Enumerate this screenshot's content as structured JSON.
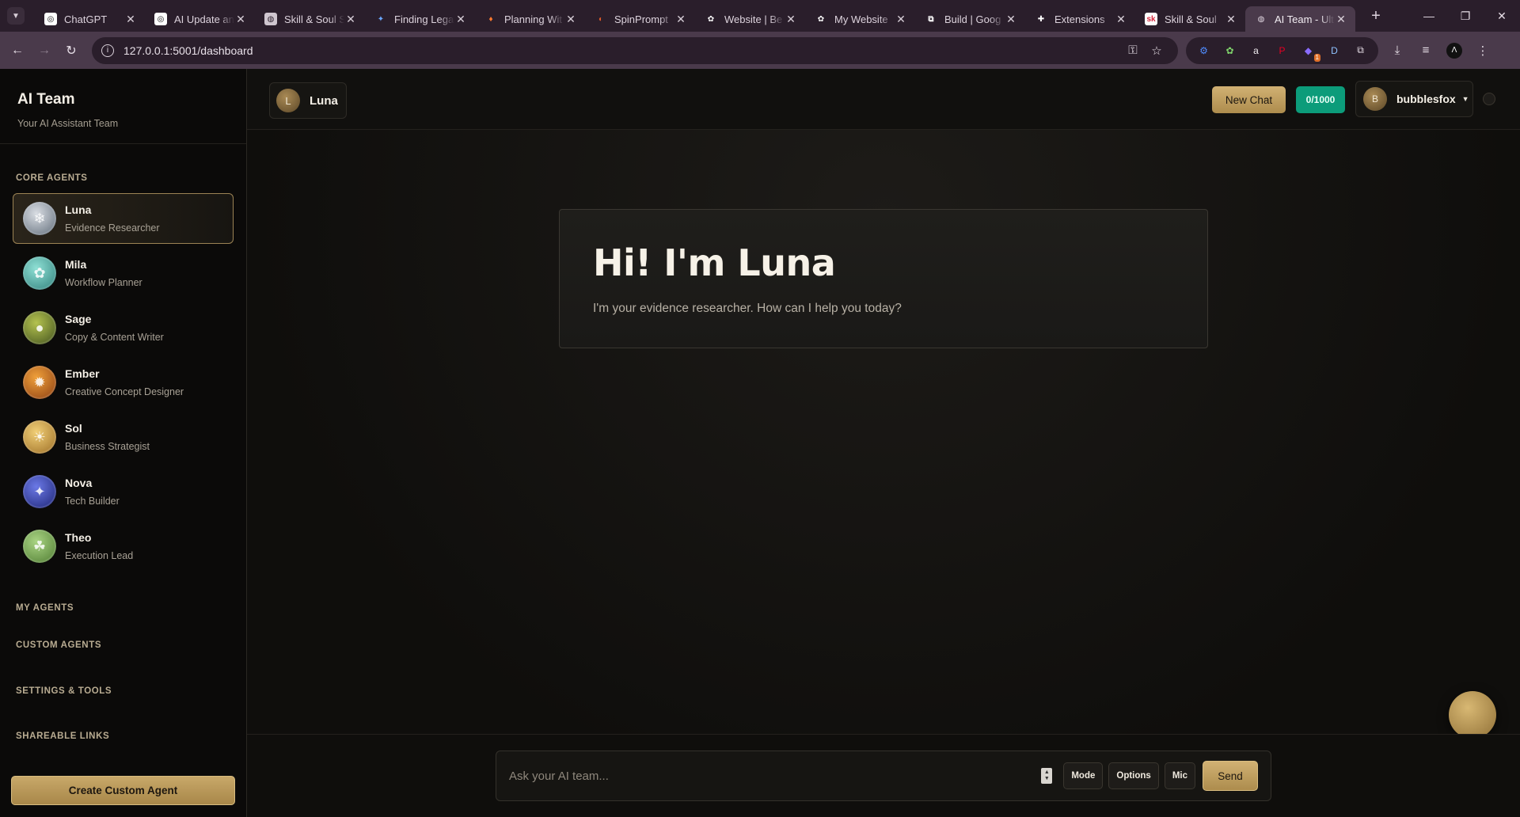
{
  "browser": {
    "tabs": [
      {
        "title": "ChatGPT",
        "favicon_bg": "#ffffff",
        "favicon_fg": "#111111",
        "favicon_glyph": "◎"
      },
      {
        "title": "AI Update and",
        "favicon_bg": "#ffffff",
        "favicon_fg": "#111111",
        "favicon_glyph": "◎"
      },
      {
        "title": "Skill & Soul S",
        "favicon_bg": "#cfc6cf",
        "favicon_fg": "#2a1e2b",
        "favicon_glyph": "◍"
      },
      {
        "title": "Finding Lega",
        "favicon_bg": "#2a1e2b",
        "favicon_fg": "#6aa7ff",
        "favicon_glyph": "✦"
      },
      {
        "title": "Planning Wit",
        "favicon_bg": "#2a1e2b",
        "favicon_fg": "#ff7a2f",
        "favicon_glyph": "♦"
      },
      {
        "title": "SpinPrompt",
        "favicon_bg": "#2a1e2b",
        "favicon_fg": "#e05a2a",
        "favicon_glyph": "◐"
      },
      {
        "title": "Website | Be",
        "favicon_bg": "#2a1e2b",
        "favicon_fg": "#ffffff",
        "favicon_glyph": "✿"
      },
      {
        "title": "My Website",
        "favicon_bg": "#2a1e2b",
        "favicon_fg": "#ffffff",
        "favicon_glyph": "✿"
      },
      {
        "title": "Build | Goog",
        "favicon_bg": "#2a1e2b",
        "favicon_fg": "#ffffff",
        "favicon_glyph": "⧉"
      },
      {
        "title": "Extensions",
        "favicon_bg": "#2a1e2b",
        "favicon_fg": "#ffffff",
        "favicon_glyph": "✚"
      },
      {
        "title": "Skill & Soul",
        "favicon_bg": "#ffffff",
        "favicon_fg": "#d6243a",
        "favicon_glyph": "sk"
      },
      {
        "title": "AI Team - Ult",
        "favicon_bg": "#4a3a4b",
        "favicon_fg": "#e0d6e0",
        "favicon_glyph": "◍",
        "active": true
      }
    ],
    "url": "127.0.0.1:5001/dashboard",
    "extensions": [
      {
        "name": "settings-extension-icon",
        "glyph": "⚙",
        "color": "#4f8cff"
      },
      {
        "name": "puzzle-green-extension-icon",
        "glyph": "✿",
        "color": "#7fd36b"
      },
      {
        "name": "a-extension-icon",
        "glyph": "a",
        "color": "#f2eef2"
      },
      {
        "name": "pinterest-extension-icon",
        "glyph": "P",
        "color": "#e60023"
      },
      {
        "name": "badge-extension-icon",
        "glyph": "◆",
        "color": "#8a6cff"
      },
      {
        "name": "d-extension-icon",
        "glyph": "D",
        "color": "#8fc3ff"
      },
      {
        "name": "extensions-puzzle-icon",
        "glyph": "⧉",
        "color": "#e8e0e8"
      }
    ],
    "extension_badge": "1"
  },
  "sidebar": {
    "brand_title": "AI Team",
    "brand_subtitle": "Your AI Assistant Team",
    "core_title": "CORE AGENTS",
    "agents": [
      {
        "name": "Luna",
        "role": "Evidence Researcher",
        "glyph": "❄",
        "bg": "radial-gradient(circle at 40% 35%, #d9dde3, #5f6b78)",
        "active": true
      },
      {
        "name": "Mila",
        "role": "Workflow Planner",
        "glyph": "✿",
        "bg": "radial-gradient(circle at 40% 35%, #8fe0d5, #2f7f7a)"
      },
      {
        "name": "Sage",
        "role": "Copy & Content Writer",
        "glyph": "●",
        "bg": "radial-gradient(circle at 40% 35%, #b4c24f, #3f4f1d)"
      },
      {
        "name": "Ember",
        "role": "Creative Concept Designer",
        "glyph": "✹",
        "bg": "radial-gradient(circle at 40% 35%, #f0a03a, #8a3d12)"
      },
      {
        "name": "Sol",
        "role": "Business Strategist",
        "glyph": "☀",
        "bg": "radial-gradient(circle at 40% 35%, #f1cf77, #9b6c24)"
      },
      {
        "name": "Nova",
        "role": "Tech Builder",
        "glyph": "✦",
        "bg": "radial-gradient(circle at 40% 35%, #6b79e6, #1c2373)"
      },
      {
        "name": "Theo",
        "role": "Execution Lead",
        "glyph": "☘",
        "bg": "radial-gradient(circle at 40% 35%, #a9d483, #4d7a30)"
      }
    ],
    "my_agents": "MY AGENTS",
    "custom_agents": "CUSTOM AGENTS",
    "settings_tools": "SETTINGS & TOOLS",
    "shareable_links": "SHAREABLE LINKS",
    "create_button": "Create Custom Agent"
  },
  "header": {
    "agent_initial": "L",
    "agent_name": "Luna",
    "new_chat": "New Chat",
    "counter": "0/1000",
    "user_initial": "B",
    "username": "bubblesfox"
  },
  "welcome": {
    "heading": "Hi! I'm Luna",
    "message": "I'm your evidence researcher. How can I help you today?"
  },
  "composer": {
    "placeholder": "Ask your AI team...",
    "mode": "Mode",
    "options": "Options",
    "mic": "Mic",
    "send": "Send"
  },
  "colors": {
    "accent_gold": "#c8a869",
    "counter_green": "#0c9c7a"
  }
}
